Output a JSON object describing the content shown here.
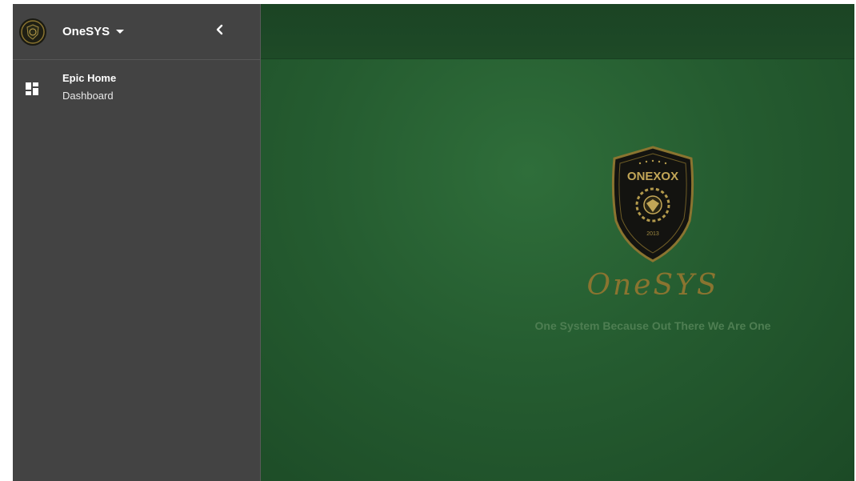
{
  "sidebar": {
    "app_name": "OneSYS",
    "logo_text": "ONEXOX",
    "items": [
      {
        "title": "Epic Home",
        "subtitle": "Dashboard",
        "icon": "dashboard-icon"
      }
    ]
  },
  "main": {
    "crest_text": "ONEXOX",
    "crest_year": "2013",
    "brand_name": "OneSYS",
    "tagline": "One System Because Out There We Are One"
  },
  "colors": {
    "sidebar_bg": "#434343",
    "main_bg": "#255c30",
    "gold": "#8a7430",
    "tagline": "#4e7e52"
  }
}
